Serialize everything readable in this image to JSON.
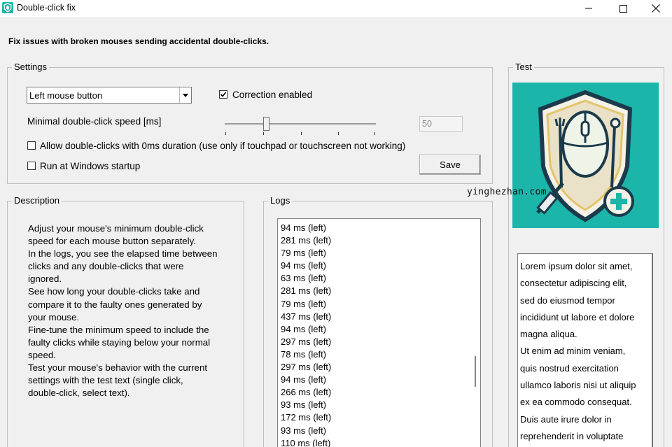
{
  "window": {
    "title": "Double-click fix"
  },
  "headline": "Fix issues with broken mouses sending accidental double-clicks.",
  "settings": {
    "group_label": "Settings",
    "button_select": {
      "value": "Left mouse button"
    },
    "correction": {
      "label": "Correction enabled",
      "checked": true
    },
    "min_speed_label": "Minimal double-click speed [ms]",
    "min_speed_value": "50",
    "slider_value": 50,
    "allow_zero": {
      "label": "Allow double-clicks with 0ms duration (use only if touchpad or touchscreen not working)",
      "checked": false
    },
    "startup": {
      "label": "Run at Windows startup",
      "checked": false
    },
    "save_label": "Save"
  },
  "description": {
    "group_label": "Description",
    "lines": [
      "Adjust your mouse's minimum double-click",
      "speed for each mouse button separately.",
      "In the logs, you see the elapsed time between",
      "clicks and any double-clicks that were",
      "ignored.",
      "See how long your double-clicks take and",
      "compare it to the faulty ones generated by",
      "your mouse.",
      "Fine-tune the minimum speed to include the",
      "faulty clicks while staying below your normal",
      "speed.",
      "Test your mouse's behavior with the current",
      "settings with the test text (single click,",
      "double-click, select text)."
    ]
  },
  "logs": {
    "group_label": "Logs",
    "entries": [
      "94 ms (left)",
      "281 ms (left)",
      "79 ms (left)",
      "94 ms (left)",
      "63 ms (left)",
      "281 ms (left)",
      "79 ms (left)",
      "437 ms (left)",
      "94 ms (left)",
      "297 ms (left)",
      "78 ms (left)",
      "297 ms (left)",
      "94 ms (left)",
      "266 ms (left)",
      "93 ms (left)",
      "172 ms (left)",
      "93 ms (left)",
      "110 ms (left)"
    ]
  },
  "test": {
    "group_label": "Test",
    "lorem_lines": [
      "Lorem ipsum dolor sit amet,",
      "consectetur adipiscing elit,",
      "sed do eiusmod tempor",
      "incididunt ut labore et dolore",
      "magna aliqua.",
      "Ut enim ad minim veniam,",
      "quis nostrud exercitation",
      "ullamco laboris nisi ut aliquip",
      "ex ea commodo consequat.",
      "Duis aute irure dolor in",
      "reprehenderit in voluptate"
    ]
  },
  "watermark": "yinghezhan.com",
  "colors": {
    "teal_bg": "#1bb5aa",
    "window_bg": "#f0f0f0"
  },
  "icons": [
    "app-icon",
    "minimize-icon",
    "maximize-icon",
    "close-icon",
    "chevron-down-icon",
    "checkmark-icon",
    "mouse-shield-illustration"
  ]
}
